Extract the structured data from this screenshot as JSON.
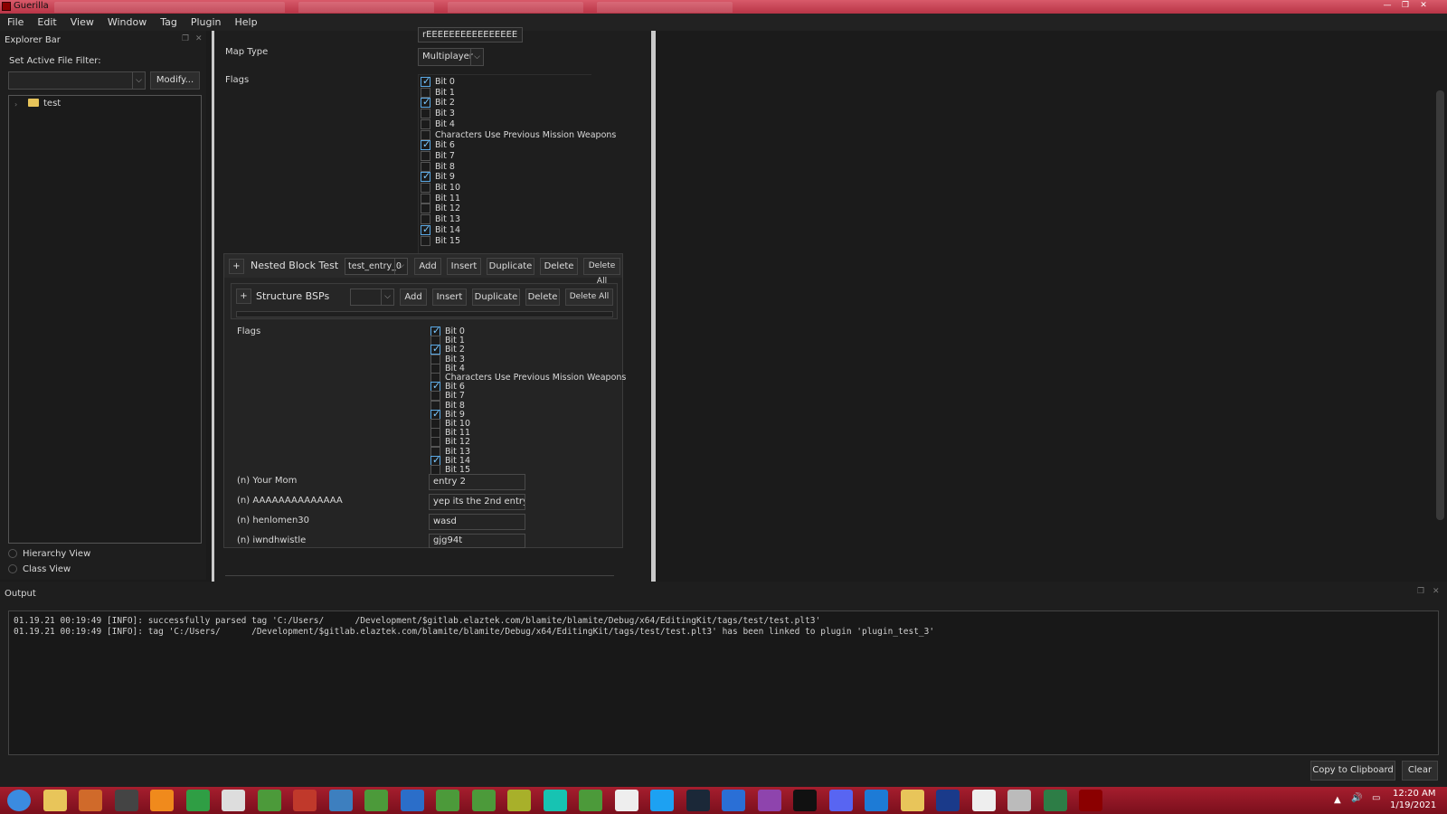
{
  "window": {
    "title": "Guerilla"
  },
  "menu": [
    "File",
    "Edit",
    "View",
    "Window",
    "Tag",
    "Plugin",
    "Help"
  ],
  "explorer": {
    "title": "Explorer Bar",
    "filter_label": "Set Active File Filter:",
    "modify_label": "Modify...",
    "tree_item": "test",
    "hierarchy_view": "Hierarchy View",
    "class_view": "Class View"
  },
  "editor": {
    "top_field_value": "rEEEEEEEEEEEEEEEE",
    "map_type_label": "Map Type",
    "map_type_value": "Multiplayer",
    "flags_label": "Flags",
    "flags": [
      {
        "label": "Bit 0",
        "checked": true
      },
      {
        "label": "Bit 1",
        "checked": false
      },
      {
        "label": "Bit 2",
        "checked": true
      },
      {
        "label": "Bit 3",
        "checked": false
      },
      {
        "label": "Bit 4",
        "checked": false
      },
      {
        "label": "Characters Use Previous Mission Weapons",
        "checked": false
      },
      {
        "label": "Bit 6",
        "checked": true
      },
      {
        "label": "Bit 7",
        "checked": false
      },
      {
        "label": "Bit 8",
        "checked": false
      },
      {
        "label": "Bit 9",
        "checked": true
      },
      {
        "label": "Bit 10",
        "checked": false
      },
      {
        "label": "Bit 11",
        "checked": false
      },
      {
        "label": "Bit 12",
        "checked": false
      },
      {
        "label": "Bit 13",
        "checked": false
      },
      {
        "label": "Bit 14",
        "checked": true
      },
      {
        "label": "Bit 15",
        "checked": false
      }
    ],
    "nested_block": {
      "expand": "+",
      "title": "Nested Block Test",
      "selected": "test_entry_0",
      "buttons": [
        "Add",
        "Insert",
        "Duplicate",
        "Delete",
        "Delete All"
      ]
    },
    "structure_block": {
      "expand": "+",
      "title": "Structure BSPs",
      "selected": "",
      "buttons": [
        "Add",
        "Insert",
        "Duplicate",
        "Delete",
        "Delete All"
      ]
    },
    "inner_flags_label": "Flags",
    "inner_flags": [
      {
        "label": "Bit 0",
        "checked": true
      },
      {
        "label": "Bit 1",
        "checked": false
      },
      {
        "label": "Bit 2",
        "checked": true
      },
      {
        "label": "Bit 3",
        "checked": false
      },
      {
        "label": "Bit 4",
        "checked": false
      },
      {
        "label": "Characters Use Previous Mission Weapons",
        "checked": false
      },
      {
        "label": "Bit 6",
        "checked": true
      },
      {
        "label": "Bit 7",
        "checked": false
      },
      {
        "label": "Bit 8",
        "checked": false
      },
      {
        "label": "Bit 9",
        "checked": true
      },
      {
        "label": "Bit 10",
        "checked": false
      },
      {
        "label": "Bit 11",
        "checked": false
      },
      {
        "label": "Bit 12",
        "checked": false
      },
      {
        "label": "Bit 13",
        "checked": false
      },
      {
        "label": "Bit 14",
        "checked": true
      },
      {
        "label": "Bit 15",
        "checked": false
      }
    ],
    "fields": [
      {
        "label": "(n) Your Mom",
        "value": "entry 2"
      },
      {
        "label": "(n) AAAAAAAAAAAAAA",
        "value": "yep its the 2nd entry"
      },
      {
        "label": "(n) henlomen30",
        "value": "wasd"
      },
      {
        "label": "(n) iwndhwistle",
        "value": "gjg94t"
      }
    ]
  },
  "output": {
    "title": "Output",
    "lines": [
      "01.19.21 00:19:49 [INFO]: successfully parsed tag 'C:/Users/      /Development/$gitlab.elaztek.com/blamite/blamite/Debug/x64/EditingKit/tags/test/test.plt3'",
      "01.19.21 00:19:49 [INFO]: tag 'C:/Users/      /Development/$gitlab.elaztek.com/blamite/blamite/Debug/x64/EditingKit/tags/test/test.plt3' has been linked to plugin 'plugin_test_3'"
    ],
    "copy_label": "Copy to Clipboard",
    "clear_label": "Clear"
  },
  "taskbar": {
    "time": "12:20 AM",
    "date": "1/19/2021",
    "icons": [
      "start-orb",
      "file-explorer",
      "media-player",
      "marketplace",
      "vlc",
      "chrome",
      "terminal",
      "minecraft",
      "paint",
      "sonic",
      "minecraft-2",
      "outlook",
      "minecraft-3",
      "minecraft-4",
      "minecraft-5",
      "gitkraken",
      "minecraft-6",
      "notepad",
      "skype",
      "steam",
      "firefox",
      "visual-studio",
      "epic-games",
      "discord",
      "virtualbox",
      "files",
      "halo",
      "window",
      "notes",
      "network",
      "guerilla"
    ],
    "colors": {
      "accent": "#a61e2e",
      "check": "#5aa9e6"
    }
  }
}
